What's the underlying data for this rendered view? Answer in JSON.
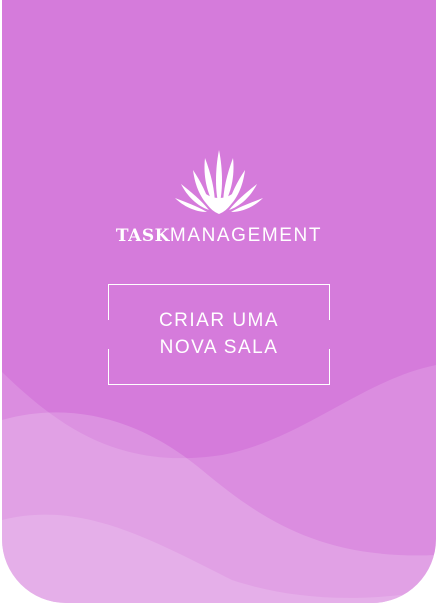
{
  "brand": {
    "logo_icon": "agave-plant-icon",
    "name_bold": "TASK",
    "name_light": "MANAGEMENT"
  },
  "cta": {
    "line1": "CRIAR UMA",
    "line2": "NOVA SALA"
  },
  "colors": {
    "background": "#d57bdb",
    "wave_light": "#e3b0e6",
    "text": "#ffffff"
  }
}
